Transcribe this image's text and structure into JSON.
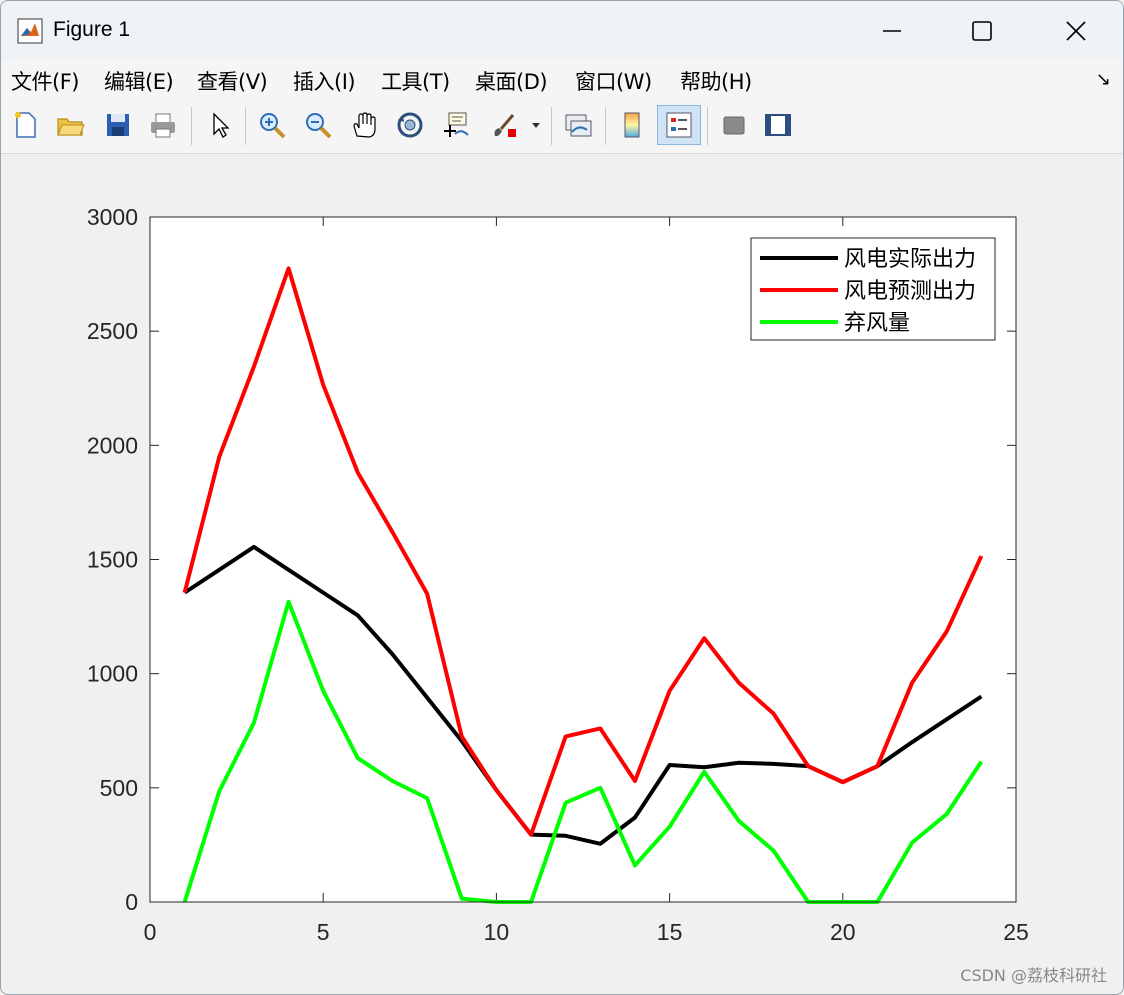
{
  "window": {
    "title": "Figure 1",
    "controls": [
      "minimize",
      "maximize",
      "close"
    ]
  },
  "menu": [
    {
      "label": "文件(F)"
    },
    {
      "label": "编辑(E)"
    },
    {
      "label": "查看(V)"
    },
    {
      "label": "插入(I)"
    },
    {
      "label": "工具(T)"
    },
    {
      "label": "桌面(D)"
    },
    {
      "label": "窗口(W)"
    },
    {
      "label": "帮助(H)"
    }
  ],
  "toolbar": [
    {
      "icon": "new-figure-icon"
    },
    {
      "icon": "open-file-icon"
    },
    {
      "icon": "save-icon"
    },
    {
      "icon": "print-icon"
    },
    {
      "icon": "edit-plot-icon"
    },
    {
      "icon": "zoom-in-icon"
    },
    {
      "icon": "zoom-out-icon"
    },
    {
      "icon": "pan-icon"
    },
    {
      "icon": "rotate-3d-icon"
    },
    {
      "icon": "data-cursor-icon"
    },
    {
      "icon": "brush-icon"
    },
    {
      "icon": "link-plot-icon"
    },
    {
      "icon": "insert-colorbar-icon"
    },
    {
      "icon": "insert-legend-icon",
      "active": true
    },
    {
      "icon": "hide-plot-tools-icon"
    },
    {
      "icon": "show-plot-tools-icon"
    }
  ],
  "chart_data": {
    "type": "line",
    "title": "",
    "xlabel": "",
    "ylabel": "",
    "xlim": [
      0,
      25
    ],
    "ylim": [
      0,
      3000
    ],
    "xticks": [
      0,
      5,
      10,
      15,
      20,
      25
    ],
    "yticks": [
      0,
      500,
      1000,
      1500,
      2000,
      2500,
      3000
    ],
    "grid": false,
    "legend_position": "top-right",
    "x": [
      1,
      2,
      3,
      4,
      5,
      6,
      7,
      8,
      9,
      10,
      11,
      12,
      13,
      14,
      15,
      16,
      17,
      18,
      19,
      20,
      21,
      22,
      23,
      24
    ],
    "series": [
      {
        "name": "风电实际出力",
        "color": "#000000",
        "values": [
          1355,
          1455,
          1555,
          1455,
          1355,
          1255,
          1085,
          895,
          705,
          490,
          295,
          290,
          255,
          370,
          600,
          590,
          610,
          605,
          595,
          525,
          595,
          700,
          800,
          900
        ]
      },
      {
        "name": "风电预测出力",
        "color": "#ff0000",
        "values": [
          1355,
          1950,
          2345,
          2775,
          2265,
          1880,
          1620,
          1350,
          725,
          490,
          295,
          725,
          760,
          530,
          925,
          1155,
          960,
          825,
          595,
          525,
          595,
          960,
          1185,
          1515
        ]
      },
      {
        "name": "弃风量",
        "color": "#00ff00",
        "values": [
          0,
          485,
          785,
          1315,
          925,
          630,
          530,
          455,
          15,
          0,
          0,
          435,
          500,
          160,
          330,
          570,
          355,
          225,
          0,
          0,
          0,
          260,
          385,
          615
        ]
      }
    ]
  },
  "watermark": "CSDN @荔枝科研社"
}
